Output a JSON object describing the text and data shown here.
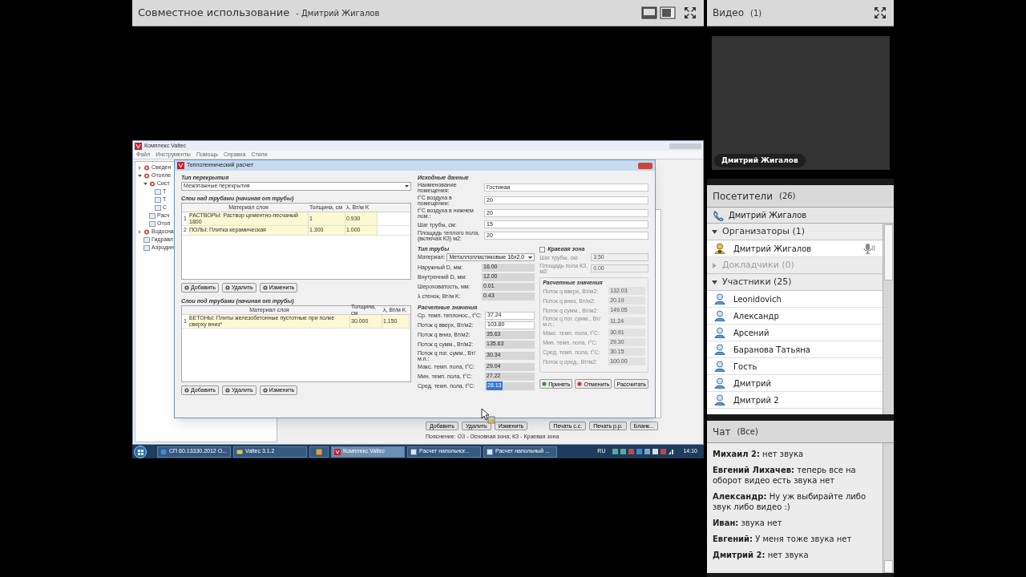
{
  "share_pod": {
    "title": "Совместное использование",
    "presenter": "- Дмитрий Жигалов",
    "desktop": {
      "app_window": {
        "title": "Комплекс Valtec",
        "menu": [
          "Файл",
          "Инструменты",
          "Помощь",
          "Справка",
          "Стили"
        ],
        "tree": [
          {
            "label": "Сведен",
            "expanded": false
          },
          {
            "label": "Отопле",
            "expanded": true,
            "children": [
              {
                "label": "Сист",
                "expanded": true,
                "children": [
                  {
                    "label": "Т"
                  },
                  {
                    "label": "Т"
                  },
                  {
                    "label": "С"
                  }
                ]
              },
              {
                "label": "Расч"
              },
              {
                "label": "Отоп"
              }
            ]
          },
          {
            "label": "Водосна",
            "expanded": false
          },
          {
            "label": "Гидравл"
          },
          {
            "label": "Аэродин"
          }
        ],
        "bottom_buttons": [
          "Добавить",
          "Удалить",
          "Изменить"
        ],
        "print_buttons": [
          "Печать с.с.",
          "Печать р.р.",
          "Бланк..."
        ],
        "legend": "Пояснение: ОЗ - Основная зона; КЗ - Краевая зона"
      },
      "dialog": {
        "title": "Теплотехнический расчет",
        "floor_type": {
          "label": "Тип перекрытия",
          "value": "Межэтажные перекрытия"
        },
        "layer_tables": [
          {
            "title": "Слои над трубами (начиная от трубы)",
            "columns": [
              "",
              "Материал слоя",
              "Толщина, см",
              "λ, Вт/м K"
            ],
            "rows": [
              [
                "1",
                "РАСТВОРЫ: Раствор цементно-песчаный 1800",
                "1",
                "0.930"
              ],
              [
                "2",
                "ПОЛЫ: Плитка керамическая",
                "1.300",
                "1.000"
              ]
            ],
            "buttons": [
              "Добавить",
              "Удалить",
              "Изменить"
            ]
          },
          {
            "title": "Слои под трубами (начиная от трубы)",
            "columns": [
              "",
              "Материал слоя",
              "Толщина, см",
              "λ, Вт/м K"
            ],
            "rows": [
              [
                "1",
                "БЕТОНЫ: Плиты железобетонные пустотные при полке сверху вниз*",
                "30.000",
                "1.150"
              ]
            ],
            "buttons": [
              "Добавить",
              "Удалить",
              "Изменить"
            ]
          }
        ],
        "source": {
          "title": "Исходные данные",
          "fields": [
            {
              "label": "Наименование помещения:",
              "value": "Гостиная"
            },
            {
              "label": "t°C воздуха в помещении:",
              "value": "20"
            },
            {
              "label": "t°C воздуха в нижнем пом.:",
              "value": "20"
            },
            {
              "label": "Шаг трубы, см:",
              "value": "15"
            },
            {
              "label": "Площадь теплого пола, (включая КЗ) м2:",
              "value": "20"
            }
          ]
        },
        "pipe": {
          "title": "Тип трубы",
          "material_label": "Материал:",
          "material": "Металлопластиковые 16x2.0",
          "fields": [
            {
              "label": "Наружный D, мм:",
              "value": "16.00"
            },
            {
              "label": "Внутренний D, мм:",
              "value": "12.00"
            },
            {
              "label": "Шероховатость, мм:",
              "value": "0.01"
            },
            {
              "label": "λ стенок, Вт/м K:",
              "value": "0.43"
            }
          ]
        },
        "results": {
          "title": "Расчетные значения",
          "rows": [
            {
              "label": "Ср. темп. теплонос., t°C:",
              "value": "37.24",
              "editable": true,
              "highlighted": false
            },
            {
              "label": "Поток q вверх, Вт/м2:",
              "value": "103.80",
              "editable": true,
              "highlighted": false
            },
            {
              "label": "Поток q вниз, Вт/м2:",
              "value": "35.63",
              "editable": false,
              "highlighted": false
            },
            {
              "label": "Поток q сумм., Вт/м2:",
              "value": "135.63",
              "editable": false,
              "highlighted": false
            },
            {
              "label": "Поток q пог. сумм., Вт/м.п.:",
              "value": "30.34",
              "editable": false,
              "highlighted": false
            },
            {
              "label": "Макс. темп. пола, t°C:",
              "value": "29.04",
              "editable": false,
              "highlighted": false
            },
            {
              "label": "Мин. темп. пола, t°C:",
              "value": "27.22",
              "editable": false,
              "highlighted": false
            },
            {
              "label": "Сред. темп. пола, t°C:",
              "value": "28.13",
              "editable": false,
              "highlighted": true
            }
          ]
        },
        "edge_zone": {
          "label": "Краевая зона",
          "checked": false,
          "fields": [
            {
              "label": "Шаг трубы, см:",
              "value": "3.50"
            },
            {
              "label": "Площадь пола КЗ, м2:",
              "value": "0.00"
            }
          ],
          "results_title": "Расчетные значения",
          "results": [
            {
              "label": "Поток q вверх, Вт/м2:",
              "value": "132.03"
            },
            {
              "label": "Поток q вниз, Вт/м2:",
              "value": "20.19"
            },
            {
              "label": "Поток q сумм., Вт/м2:",
              "value": "149.05"
            },
            {
              "label": "Поток q пог. сумм., Вт/м.п.:",
              "value": "11.24"
            },
            {
              "label": "Макс. темп. пола, t°C:",
              "value": "30.91"
            },
            {
              "label": "Мин. темп. пола, t°C:",
              "value": "29.30"
            },
            {
              "label": "Сред. темп. пола, t°C:",
              "value": "30.15"
            },
            {
              "label": "Поток q сред., Вт/м2:",
              "value": "100.00"
            }
          ]
        },
        "actions": [
          {
            "label": "Принять",
            "kind": "accept"
          },
          {
            "label": "Отменить",
            "kind": "cancel"
          },
          {
            "label": "Рассчитать",
            "kind": "plain"
          }
        ]
      },
      "taskbar": {
        "items": [
          {
            "label": "СП 60.13330.2012 О...",
            "kind": "browser",
            "active": false
          },
          {
            "label": "Valtec 3.1.2",
            "kind": "folder",
            "active": false
          },
          {
            "kind": "media",
            "active": false
          },
          {
            "label": "Комплекс Valtec",
            "kind": "valtec",
            "active": true
          },
          {
            "label": "Расчет напольног...",
            "kind": "window",
            "active": false
          },
          {
            "label": "Расчет напольный ...",
            "kind": "window",
            "active": false
          }
        ],
        "language": "RU",
        "clock": "14:10"
      }
    }
  },
  "video_pod": {
    "title": "Видео",
    "count": "(1)",
    "name_tag": "Дмитрий Жигалов"
  },
  "attendees_pod": {
    "title": "Посетители",
    "count": "(26)",
    "phone_user": "Дмитрий Жигалов",
    "groups": [
      {
        "label": "Организаторы (1)",
        "expanded": true,
        "members": [
          {
            "name": "Дмитрий Жигалов",
            "kind": "host",
            "speaking": true
          }
        ]
      },
      {
        "label": "Докладчики (0)",
        "expanded": false
      },
      {
        "label": "Участники (25)",
        "expanded": true,
        "members": [
          {
            "name": "Leonidovich",
            "kind": "guest",
            "speaking": false
          },
          {
            "name": "Александр",
            "kind": "guest",
            "speaking": false
          },
          {
            "name": "Арсений",
            "kind": "guest",
            "speaking": false
          },
          {
            "name": "Баранова Татьяна",
            "kind": "guest",
            "speaking": false
          },
          {
            "name": "Гость",
            "kind": "guest",
            "speaking": false
          },
          {
            "name": "Дмитрий",
            "kind": "guest",
            "speaking": false
          },
          {
            "name": "Дмитрий 2",
            "kind": "guest",
            "speaking": false
          }
        ]
      }
    ]
  },
  "chat_pod": {
    "title": "Чат",
    "scope": "(Все)",
    "messages": [
      {
        "author": "Михаил 2:",
        "text": "нет звука"
      },
      {
        "author": "Евгений Лихачев:",
        "text": "теперь все на оборот видео есть звука нет"
      },
      {
        "author": "Александр:",
        "text": "Ну уж выбирайте либо звук либо видео :)"
      },
      {
        "author": "Иван:",
        "text": "звука нет"
      },
      {
        "author": "Евгений:",
        "text": "У меня тоже звука нет"
      },
      {
        "author": "Дмитрий 2:",
        "text": "нет звука"
      }
    ]
  }
}
